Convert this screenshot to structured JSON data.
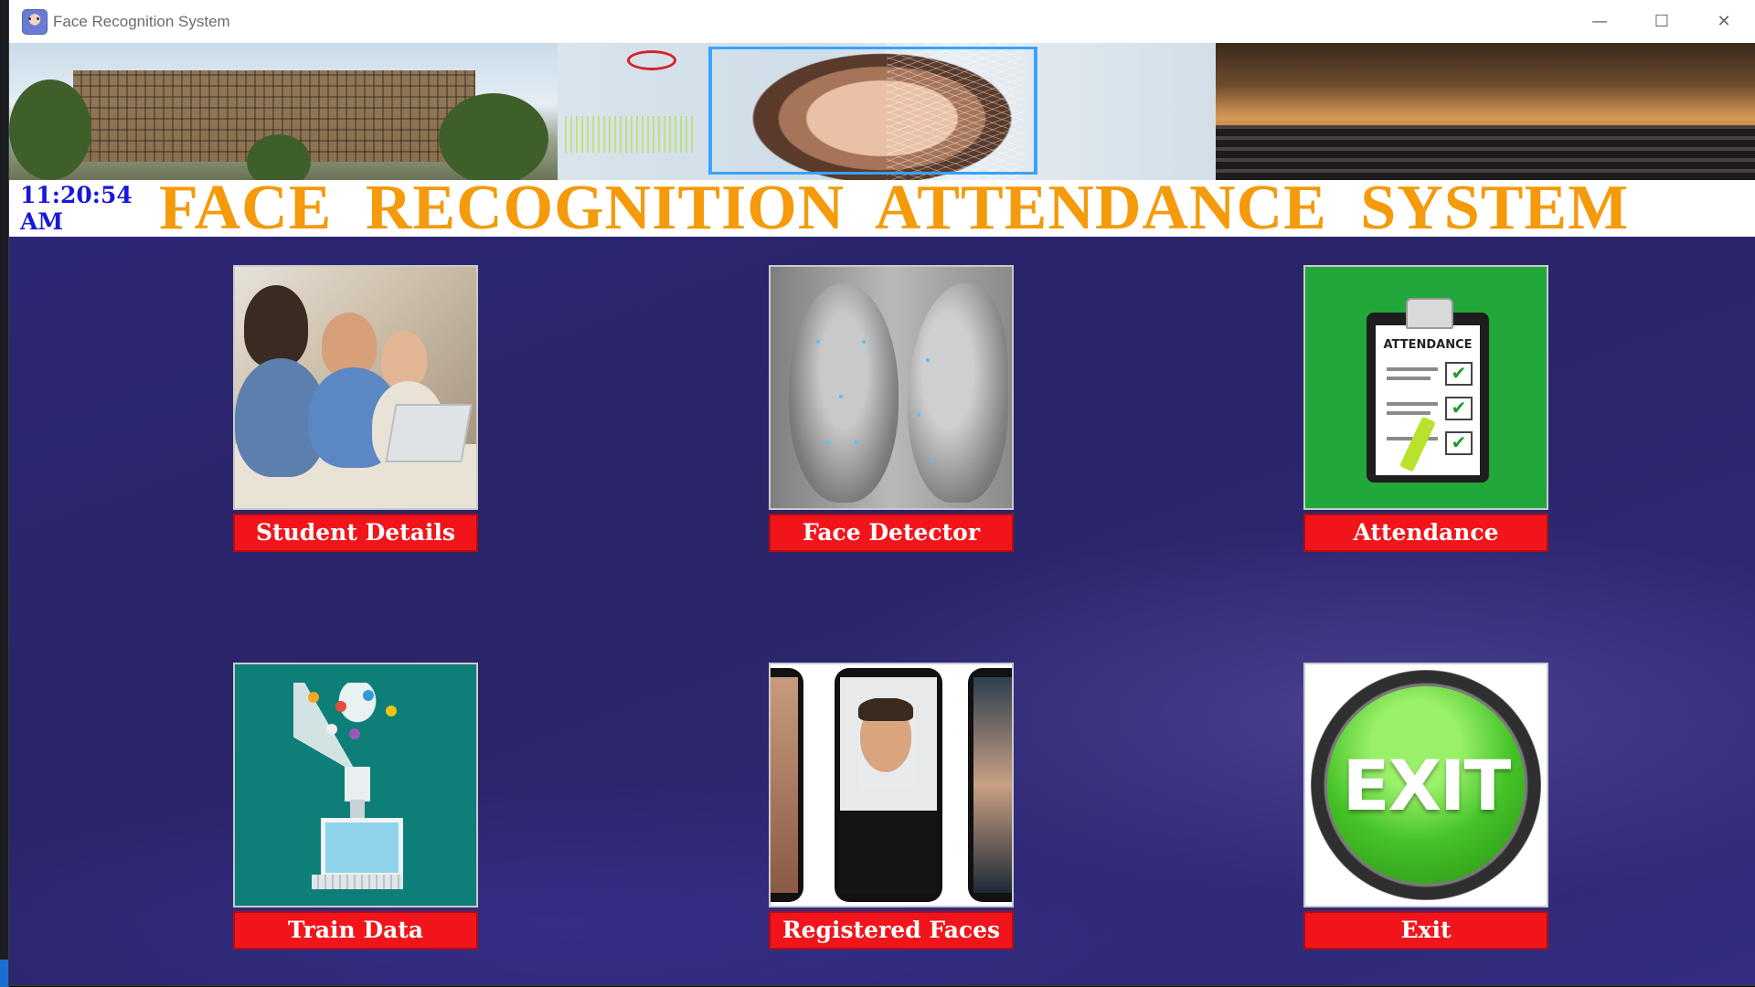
{
  "window": {
    "title": "Face Recognition System"
  },
  "controls": {
    "minimize": "—",
    "maximize": "☐",
    "close": "✕"
  },
  "header": {
    "clock": "11:20:54 AM",
    "heading": "FACE  RECOGNITION  ATTENDANCE  SYSTEM"
  },
  "tiles": [
    {
      "label": "Student Details",
      "icon": "students-image"
    },
    {
      "label": "Face Detector",
      "icon": "face-landmarks-image"
    },
    {
      "label": "Attendance",
      "icon": "attendance-clipboard-image",
      "image_text": "ATTENDANCE",
      "checks": [
        "✔",
        "✔",
        "✔"
      ]
    },
    {
      "label": "Train Data",
      "icon": "data-funnel-computer-image"
    },
    {
      "label": "Registered Faces",
      "icon": "phones-faces-image"
    },
    {
      "label": "Exit",
      "icon": "exit-button-image",
      "image_text": "EXIT"
    }
  ],
  "colors": {
    "heading": "#f49a0b",
    "clock": "#1818d8",
    "button_bg": "#f1151b",
    "background": "#2a2468"
  }
}
